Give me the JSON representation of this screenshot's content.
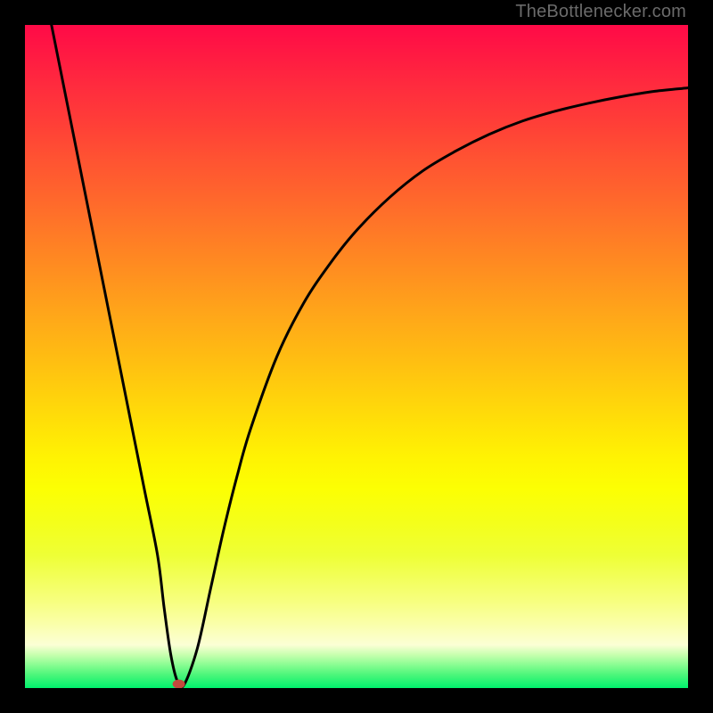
{
  "watermark": "TheBottlenecker.com",
  "chart_data": {
    "type": "line",
    "title": "",
    "xlabel": "",
    "ylabel": "",
    "xlim": [
      0,
      100
    ],
    "ylim": [
      0,
      100
    ],
    "grid": false,
    "gradient_stops": [
      {
        "offset": 0.0,
        "color": "#ff0a47"
      },
      {
        "offset": 0.05,
        "color": "#ff1c42"
      },
      {
        "offset": 0.1,
        "color": "#ff2e3d"
      },
      {
        "offset": 0.15,
        "color": "#ff3f37"
      },
      {
        "offset": 0.2,
        "color": "#ff5232"
      },
      {
        "offset": 0.25,
        "color": "#ff632d"
      },
      {
        "offset": 0.3,
        "color": "#ff7528"
      },
      {
        "offset": 0.35,
        "color": "#ff8722"
      },
      {
        "offset": 0.4,
        "color": "#ff991d"
      },
      {
        "offset": 0.45,
        "color": "#ffab18"
      },
      {
        "offset": 0.5,
        "color": "#ffbc12"
      },
      {
        "offset": 0.55,
        "color": "#ffce0d"
      },
      {
        "offset": 0.6,
        "color": "#ffe008"
      },
      {
        "offset": 0.65,
        "color": "#fff203"
      },
      {
        "offset": 0.7,
        "color": "#fcff03"
      },
      {
        "offset": 0.75,
        "color": "#f4ff1a"
      },
      {
        "offset": 0.8,
        "color": "#eeff36"
      },
      {
        "offset": 0.83,
        "color": "#f2ff56"
      },
      {
        "offset": 0.87,
        "color": "#f7ff80"
      },
      {
        "offset": 0.9,
        "color": "#faffa5"
      },
      {
        "offset": 0.92,
        "color": "#fbffc1"
      },
      {
        "offset": 0.935,
        "color": "#fbffd5"
      },
      {
        "offset": 0.95,
        "color": "#c7ffae"
      },
      {
        "offset": 0.965,
        "color": "#89fd92"
      },
      {
        "offset": 0.98,
        "color": "#4cf67a"
      },
      {
        "offset": 1.0,
        "color": "#00f16d"
      }
    ],
    "series": [
      {
        "name": "bottleneck-curve",
        "color": "#000000",
        "stroke_width": 3,
        "x": [
          4,
          6,
          8,
          10,
          12,
          14,
          16,
          18,
          20,
          21,
          22,
          23,
          24,
          26,
          28,
          30,
          32,
          34,
          38,
          42,
          46,
          50,
          55,
          60,
          65,
          70,
          75,
          80,
          85,
          90,
          95,
          100
        ],
        "y": [
          100,
          90,
          80,
          70,
          60,
          50,
          40,
          30,
          20,
          12,
          5,
          1,
          0.5,
          6,
          15,
          24,
          32,
          39,
          50,
          58,
          64,
          69,
          74,
          78,
          81,
          83.5,
          85.5,
          87,
          88.2,
          89.2,
          90,
          90.5
        ]
      }
    ],
    "marker": {
      "x": 23.2,
      "y": 0.6,
      "rx": 7,
      "ry": 5,
      "color": "#c24a3d"
    }
  }
}
